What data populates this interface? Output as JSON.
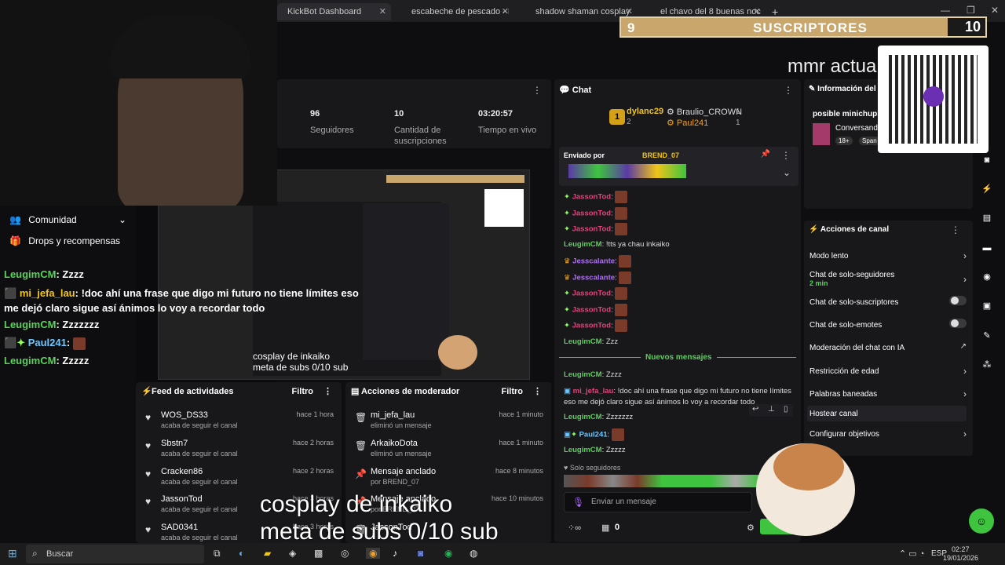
{
  "browser": {
    "tabs": [
      {
        "label": "KickBot Dashboard"
      },
      {
        "label": "escabeche de pescado - Buscar"
      },
      {
        "label": "shadow shaman cosplay - Busc"
      },
      {
        "label": "el chavo del 8 buenas noches"
      }
    ],
    "new_tab": "+"
  },
  "overlay": {
    "subs_left": "9",
    "subs_label": "SUSCRIPTORES",
    "subs_right": "10",
    "mmr": "mmr actua",
    "caption_line1": "cosplay de inkaiko",
    "caption_line2": "meta de subs  0/10 sub"
  },
  "stats": {
    "followers_value": "96",
    "followers_label": "Seguidores",
    "subs_value": "10",
    "subs_label_1": "Cantidad de",
    "subs_label_2": "suscripciones",
    "time_value": "03:20:57",
    "time_label": "Tiempo en vivo"
  },
  "community": {
    "community_label": "Comunidad",
    "drops_label": "Drops y recompensas"
  },
  "left_chat": [
    {
      "user": "LeugimCM",
      "text": "Zzzz"
    },
    {
      "user": "mi_jefa_lau",
      "text": "!doc ahí una frase que digo mi futuro no tiene límites eso me dejó claro sigue así ánimos lo voy a recordar todo"
    },
    {
      "user": "LeugimCM",
      "text": "Zzzzzzz"
    },
    {
      "user": "Paul241",
      "text": ""
    },
    {
      "user": "LeugimCM",
      "text": "Zzzzz"
    }
  ],
  "feed": {
    "title": "Feed de actividades",
    "filter": "Filtro",
    "items": [
      {
        "name": "WOS_DS33",
        "sub": "acaba de seguir el canal",
        "time": "hace 1 hora"
      },
      {
        "name": "Sbstn7",
        "sub": "acaba de seguir el canal",
        "time": "hace 2 horas"
      },
      {
        "name": "Cracken86",
        "sub": "acaba de seguir el canal",
        "time": "hace 2 horas"
      },
      {
        "name": "JassonTod",
        "sub": "acaba de seguir el canal",
        "time": "hace 3 horas"
      },
      {
        "name": "SAD0341",
        "sub": "acaba de seguir el canal",
        "time": "hace 3 horas"
      }
    ]
  },
  "mod_actions": {
    "title": "Acciones de moderador",
    "filter": "Filtro",
    "items": [
      {
        "name": "mi_jefa_lau",
        "sub": "eliminó un mensaje",
        "time": "hace 1 minuto"
      },
      {
        "name": "ArkaikoDota",
        "sub": "eliminó un mensaje",
        "time": "hace 1 minuto"
      },
      {
        "name": "Mensaje anclado",
        "sub": "por BREND_07",
        "time": "hace 8 minutos"
      },
      {
        "name": "Mensaje anclado",
        "sub": "por BREND_07",
        "time": "hace 10 minutos"
      },
      {
        "name": "JassonTod",
        "sub": "",
        "time": ""
      }
    ]
  },
  "chat": {
    "title": "Chat",
    "leaderboard": {
      "rank": "1",
      "first_user": "dylanc29",
      "first_count": "2",
      "second_user": "Braulio_CROWN",
      "second_count": "1",
      "third_user": "Paul241",
      "third_count": "1"
    },
    "pinned_prefix": "Enviado por",
    "pinned_user": "BREND_07",
    "messages": [
      {
        "user": "JassonTod",
        "text": "",
        "color": "pink"
      },
      {
        "user": "JassonTod",
        "text": "",
        "color": "pink"
      },
      {
        "user": "JassonTod",
        "text": "",
        "color": "pink"
      },
      {
        "user": "LeugimCM",
        "text": "!tts ya chau inkaiko",
        "color": "green"
      },
      {
        "user": "Jesscalante",
        "text": "",
        "color": "purple"
      },
      {
        "user": "Jesscalante",
        "text": "",
        "color": "purple"
      },
      {
        "user": "JassonTod",
        "text": "",
        "color": "pink"
      },
      {
        "user": "JassonTod",
        "text": "",
        "color": "pink"
      },
      {
        "user": "JassonTod",
        "text": "",
        "color": "pink"
      },
      {
        "user": "LeugimCM",
        "text": "Zzz",
        "color": "green"
      }
    ],
    "new_messages": "Nuevos mensajes",
    "after_messages": [
      {
        "user": "LeugimCM",
        "text": "Zzzz"
      },
      {
        "user": "mi_jefa_lau",
        "text": "!doc ahí una frase que digo mi futuro no tiene límites eso me dejó claro sigue así ánimos lo voy a recordar todo"
      },
      {
        "user": "LeugimCM",
        "text": "Zzzzzzz"
      },
      {
        "user": "Paul241",
        "text": ""
      },
      {
        "user": "LeugimCM",
        "text": "Zzzzz"
      }
    ],
    "followers_only": "Solo seguidores",
    "input_placeholder": "Enviar un mensaje",
    "points": "0"
  },
  "info": {
    "title": "Información del",
    "possible": "posible minichupi",
    "conversando": "Conversand",
    "age": "18+",
    "lang": "Span"
  },
  "channel_actions": {
    "title": "Acciones de canal",
    "items": [
      {
        "label": "Modo lento",
        "control": "chevron"
      },
      {
        "label": "Chat de solo-seguidores",
        "sub": "2 min",
        "control": "chevron"
      },
      {
        "label": "Chat de solo-suscriptores",
        "control": "toggle"
      },
      {
        "label": "Chat de solo-emotes",
        "control": "toggle"
      },
      {
        "label": "Moderación del chat con IA",
        "control": "external"
      },
      {
        "label": "Restricción de edad",
        "control": "chevron"
      },
      {
        "label": "Palabras baneadas",
        "control": "chevron"
      },
      {
        "label": "Hostear canal",
        "control": "none"
      },
      {
        "label": "Configurar objetivos",
        "control": "chevron"
      }
    ]
  },
  "taskbar": {
    "search": "Buscar",
    "lang": "ESP",
    "time": "02:27",
    "date": "19/01/2026"
  }
}
